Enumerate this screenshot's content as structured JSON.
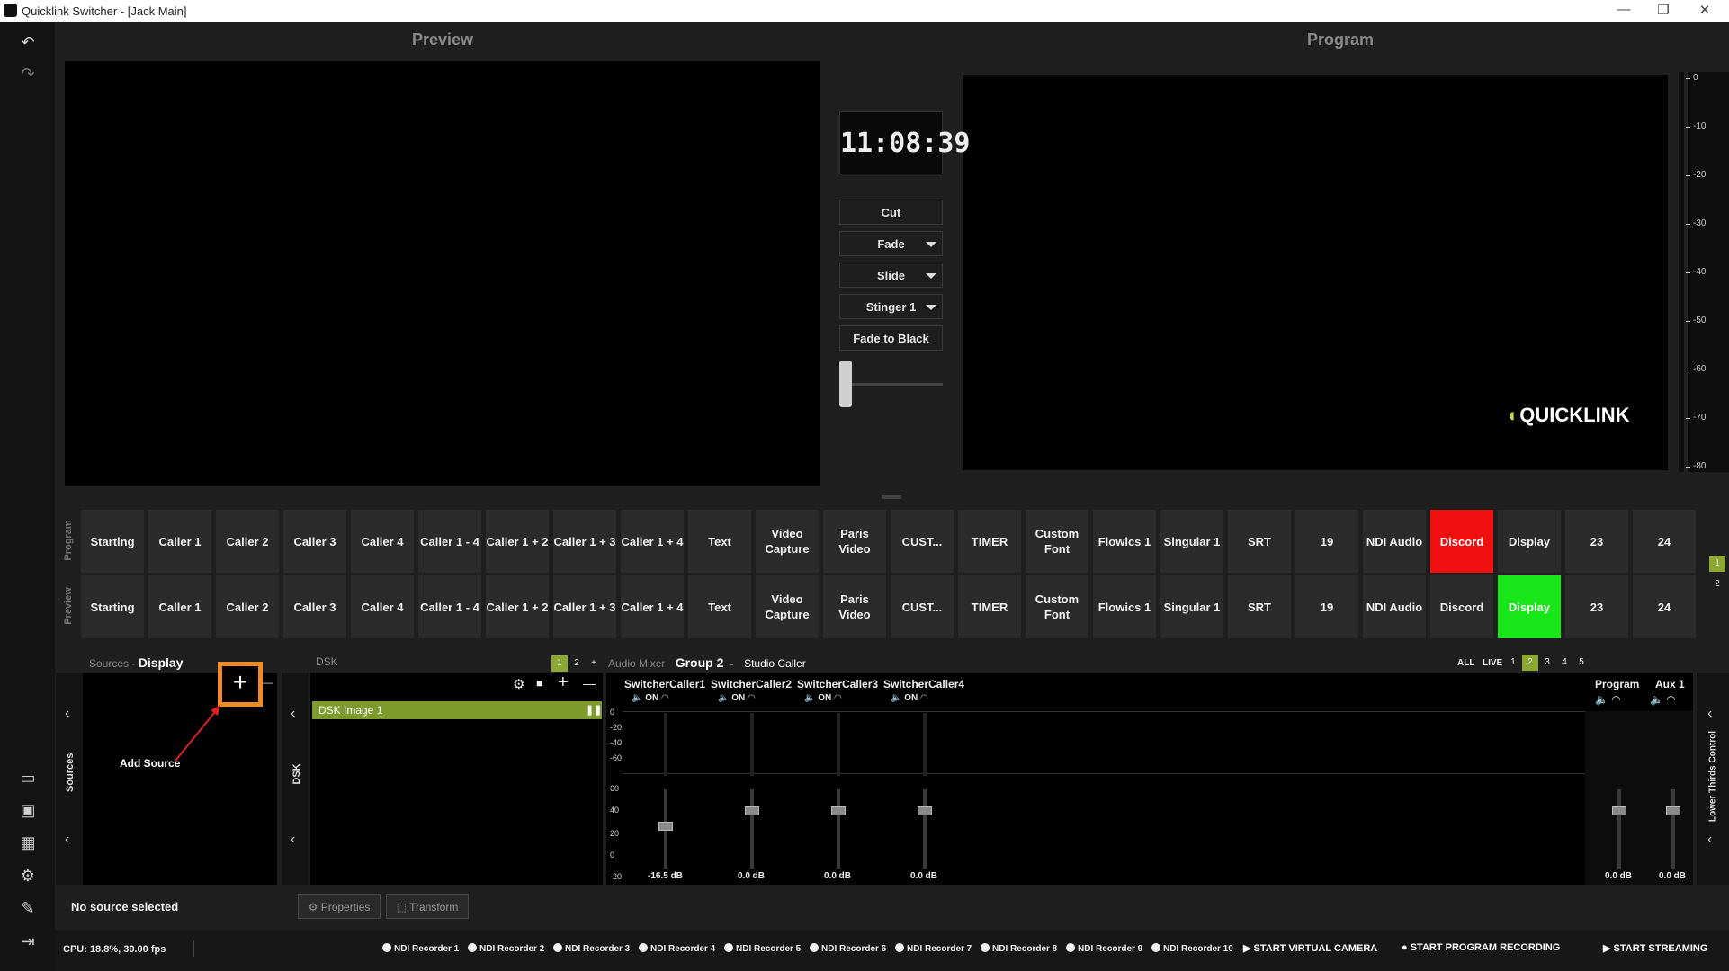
{
  "window": {
    "title": "Quicklink Switcher - [Jack Main]",
    "controls": [
      "—",
      "❐",
      "✕"
    ]
  },
  "leftbar": {
    "icons": [
      "undo-icon",
      "redo-icon",
      "monitor-icon",
      "multiview-icon",
      "layout-icon",
      "settings-icon",
      "tools-icon",
      "exit-icon"
    ]
  },
  "preview": {
    "title": "Preview"
  },
  "program": {
    "title": "Program",
    "logo_text": "QUICKLINK"
  },
  "clock": "11:08:39",
  "transitions": {
    "cut": "Cut",
    "fade": "Fade",
    "slide": "Slide",
    "stinger": "Stinger 1",
    "ftb": "Fade to Black",
    "tbar_level": 0
  },
  "meter_ticks": [
    "0",
    "-10",
    "-20",
    "-30",
    "-40",
    "-50",
    "-60",
    "-70",
    "-80"
  ],
  "rows": {
    "program_label": "Program",
    "preview_label": "Preview",
    "page_tabs": [
      "1",
      "2"
    ]
  },
  "sources": [
    "Starting",
    "Caller 1",
    "Caller 2",
    "Caller 3",
    "Caller 4",
    "Caller 1 - 4",
    "Caller 1 + 2",
    "Caller 1 + 3",
    "Caller 1 + 4",
    "Text",
    "Video Capture",
    "Paris Video",
    "CUST...",
    "TIMER",
    "Custom Font",
    "Flowics 1",
    "Singular 1",
    "SRT",
    "19",
    "NDI Audio",
    "Discord",
    "Display",
    "23",
    "24"
  ],
  "program_live": "Discord",
  "preview_live": "Display",
  "colors": {
    "program_live": "#f01010",
    "preview_live": "#19e619",
    "accent": "#8aa832",
    "highlight": "#f08a24"
  },
  "sources_panel": {
    "header": "Sources",
    "scene": "Display",
    "side_label": "Sources",
    "add_label": "Add Source",
    "add_symbol": "+",
    "remove_symbol": "—",
    "chev_left": "‹"
  },
  "dsk": {
    "header": "DSK",
    "tabs": [
      "1",
      "2",
      "+"
    ],
    "side_label": "DSK",
    "item": "DSK Image 1",
    "item_icon": "pause-icon",
    "icons": [
      "gear-icon",
      "lock-icon",
      "plus-icon",
      "minus-icon"
    ],
    "add_symbol": "+",
    "remove_symbol": "—",
    "pause_symbol": "❚❚"
  },
  "audio": {
    "header": "Audio Mixer",
    "group": "Group 2",
    "sep": "-",
    "subtitle": "Studio Caller",
    "filters": [
      "ALL",
      "LIVE",
      "1",
      "2",
      "3",
      "4",
      "5"
    ],
    "active_filter": "2",
    "scale": [
      "0",
      "-20",
      "-40",
      "-60",
      "60",
      "40",
      "20",
      "0",
      "-20",
      "-40",
      "-60"
    ],
    "channels": [
      {
        "name": "SwitcherCaller1",
        "state": "ON",
        "db": "-16.5 dB"
      },
      {
        "name": "SwitcherCaller2",
        "state": "ON",
        "db": "0.0 dB"
      },
      {
        "name": "SwitcherCaller3",
        "state": "ON",
        "db": "0.0 dB"
      },
      {
        "name": "SwitcherCaller4",
        "state": "ON",
        "db": "0.0 dB"
      }
    ],
    "outputs": [
      {
        "name": "Program",
        "db": "0.0 dB"
      },
      {
        "name": "Aux 1",
        "db": "0.0 dB"
      }
    ]
  },
  "lower_thirds": {
    "label": "Lower Thirds Control"
  },
  "status": {
    "no_source": "No source selected",
    "properties": "Properties",
    "transform": "Transform",
    "cpu": "CPU: 18.8%, 30.00 fps"
  },
  "recorders": [
    "NDI Recorder 1",
    "NDI Recorder 2",
    "NDI Recorder 3",
    "NDI Recorder 4",
    "NDI Recorder 5",
    "NDI Recorder 6",
    "NDI Recorder 7",
    "NDI Recorder 8",
    "NDI Recorder 9",
    "NDI Recorder 10"
  ],
  "actions": {
    "virtual_camera": "START VIRTUAL CAMERA",
    "program_recording": "START PROGRAM RECORDING",
    "streaming": "START STREAMING"
  }
}
